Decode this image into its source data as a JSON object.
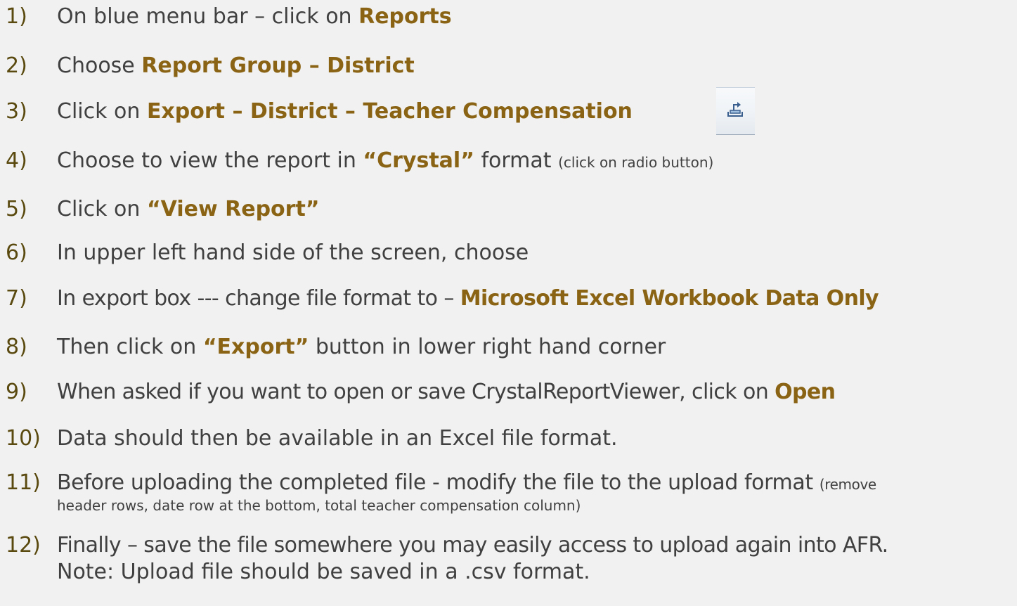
{
  "steps": [
    {
      "num": "1)",
      "text": "On blue menu bar – click on ",
      "bold": "Reports"
    },
    {
      "num": "2)",
      "text": "Choose ",
      "bold": "Report Group – District"
    },
    {
      "num": "3)",
      "text": "Click on ",
      "bold": "Export – District – Teacher Compensation"
    },
    {
      "num": "4)",
      "text": "Choose to view the report in ",
      "bold": "“Crystal”",
      "text_after": " format ",
      "small": "(click on radio button)"
    },
    {
      "num": "5)",
      "text": "Click on ",
      "bold": "“View Report”"
    },
    {
      "num": "6)",
      "text": "In upper left hand side of the screen, choose"
    },
    {
      "num": "7)",
      "text": "In export box --- change file format to – ",
      "bold": "Microsoft Excel Workbook Data Only"
    },
    {
      "num": "8)",
      "text": "Then click on ",
      "bold": "“Export”",
      "text_after": " button in lower right hand corner"
    },
    {
      "num": "9)",
      "text": "When asked if you want to open or save CrystalReportViewer, click on ",
      "bold": "Open"
    },
    {
      "num": "10)",
      "text": "Data should then be available in an Excel file format."
    },
    {
      "num": "11)",
      "text": "Before uploading the completed file - modify the file to the upload format ",
      "small": "(remove",
      "line2_small": "header rows, date row at the bottom, total teacher compensation column)"
    },
    {
      "num": "12)",
      "text": "Finally – save the file somewhere you may easily access to upload again into AFR.",
      "line2": "Note:  Upload file should be saved in a .csv format."
    }
  ],
  "icons": {
    "export": "export-icon"
  },
  "colors": {
    "background": "#f1f1f1",
    "text": "#404040",
    "highlight": "#8a6414",
    "number": "#5a4a10"
  }
}
